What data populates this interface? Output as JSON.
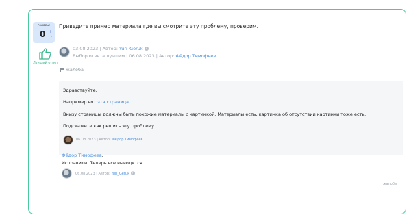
{
  "vote": {
    "label": "голосы:",
    "count": "0",
    "up": "+",
    "down": "-"
  },
  "best_answer": {
    "label": "Лучший ответ"
  },
  "question_comment": "Приведите пример материала где вы смотрите эту проблему, проверим.",
  "meta1": {
    "date": "03.08.2023",
    "author_prefix": "Автор:",
    "author": "Yuri_Geruk",
    "info_icon": "?"
  },
  "meta2": {
    "best_text": "Выбор ответа лучшим | 06.08.2023",
    "author_prefix": "Автор:",
    "author": "Фёдор Тимофеев"
  },
  "complaint_label": "жалоба",
  "answer": {
    "greeting": "Здравствуйте.",
    "example_prefix": "Например вот",
    "example_link": "эта страница.",
    "problem": "Внизу страницы должны быть похожие материалы с картинкой. Материалы есть, картинка об отсутствии картинки тоже есть.",
    "question": "Подскажете как решить эту проблему.",
    "meta_date": "06.08.2023",
    "meta_author_prefix": "Автор:",
    "meta_author": "Фёдор Тимофеев"
  },
  "reply": {
    "to_author": "Фёдор Тимофеев",
    "comma": ",",
    "text": "Исправили. Теперь все выводится.",
    "meta_date": "06.08.2023",
    "meta_author_prefix": "Автор:",
    "meta_author": "Yuri_Geruk",
    "info_icon": "?"
  },
  "bottom_complaint": "жалоба",
  "colors": {
    "accent": "#4cc9a0",
    "link": "#4b8fdc",
    "vote_bg": "#d9e7fb"
  }
}
